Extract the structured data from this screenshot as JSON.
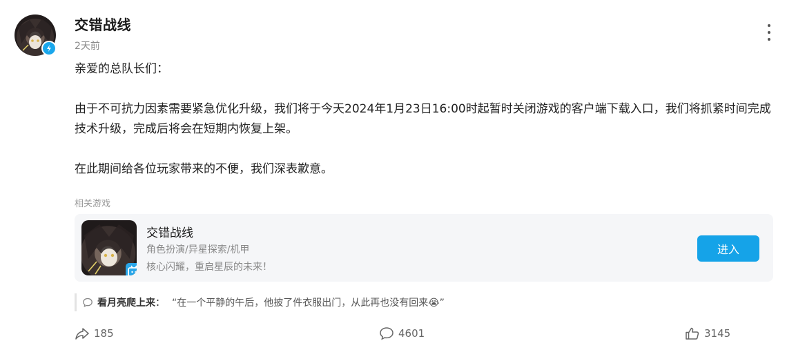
{
  "post": {
    "author": "交错战线",
    "time": "2天前",
    "content": {
      "greeting": "亲爱的总队长们：",
      "paragraph1": "由于不可抗力因素需要紧急优化升级，我们将于今天2024年1月23日16:00时起暂时关闭游戏的客户端下载入口，我们将抓紧时间完成技术升级，完成后将会在短期内恢复上架。",
      "paragraph2": "在此期间给各位玩家带来的不便，我们深表歉意。"
    },
    "related_label": "相关游戏"
  },
  "game_card": {
    "title": "交错战线",
    "tags": "角色扮演/异星探索/机甲",
    "slogan": "核心闪耀，重启星辰的未来！",
    "enter_label": "进入"
  },
  "hot_comment": {
    "user": "看月亮爬上来",
    "sep": "：",
    "text": "“在一个平静的午后，他披了件衣服出门，从此再也没有回来😭”"
  },
  "actions": {
    "share_count": "185",
    "comment_count": "4601",
    "like_count": "3145"
  },
  "colors": {
    "accent": "#15a3e8",
    "verify_badge": "#1aa7ec",
    "card_bg": "#f5f6f8"
  },
  "icons": [
    "verified-icon",
    "more-icon",
    "bilibili-icon",
    "comment-bubble-icon",
    "share-icon",
    "comment-icon",
    "thumbs-up-icon"
  ]
}
